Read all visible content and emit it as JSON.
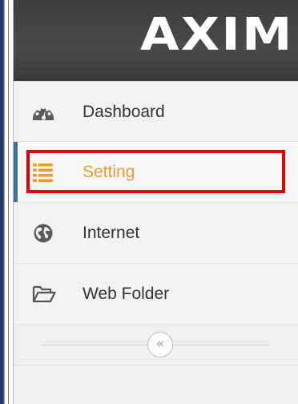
{
  "header": {
    "logo_text": "AXIM"
  },
  "sidebar": {
    "items": [
      {
        "label": "Dashboard",
        "icon": "dashboard-icon",
        "active": false
      },
      {
        "label": "Setting",
        "icon": "list-icon",
        "active": true
      },
      {
        "label": "Internet",
        "icon": "globe-icon",
        "active": false
      },
      {
        "label": "Web Folder",
        "icon": "folder-open-icon",
        "active": false
      }
    ],
    "collapse_glyph": "«"
  },
  "colors": {
    "active_text": "#ee9a2c",
    "active_bar": "#3f6f9c",
    "highlight_border": "#e60000",
    "header_bg": "#444444"
  }
}
